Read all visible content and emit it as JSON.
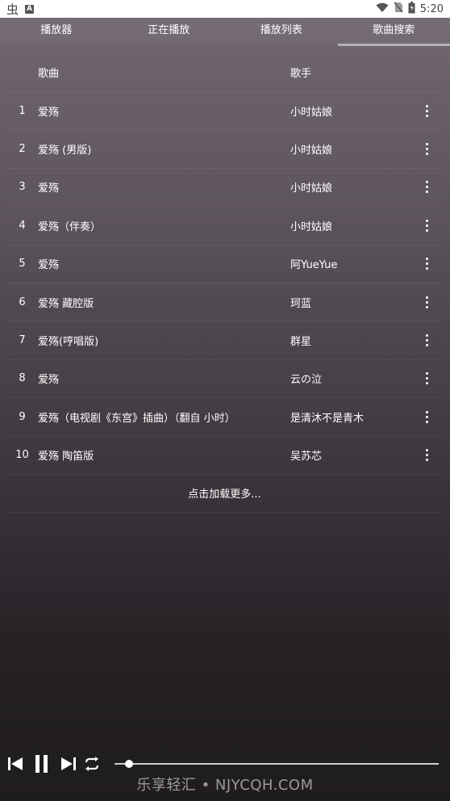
{
  "status_bar": {
    "time": "5:20",
    "notification_glyph": "虫",
    "notification_badge": "A",
    "icons": [
      "wifi-icon",
      "no-sim-icon",
      "battery-icon"
    ]
  },
  "tabs": [
    {
      "label": "播放器",
      "active": false
    },
    {
      "label": "正在播放",
      "active": false
    },
    {
      "label": "播放列表",
      "active": false
    },
    {
      "label": "歌曲搜索",
      "active": true
    }
  ],
  "list": {
    "header_song": "歌曲",
    "header_artist": "歌手",
    "rows": [
      {
        "num": "1",
        "song": "爱殇",
        "artist": "小时姑娘"
      },
      {
        "num": "2",
        "song": "爱殇 (男版)",
        "artist": "小时姑娘"
      },
      {
        "num": "3",
        "song": "爱殇",
        "artist": "小时姑娘"
      },
      {
        "num": "4",
        "song": "爱殇（伴奏）",
        "artist": "小时姑娘"
      },
      {
        "num": "5",
        "song": "爱殇",
        "artist": "阿YueYue"
      },
      {
        "num": "6",
        "song": "爱殇 藏腔版",
        "artist": "珂蓝"
      },
      {
        "num": "7",
        "song": "爱殇(哼唱版)",
        "artist": "群星"
      },
      {
        "num": "8",
        "song": "爱殇",
        "artist": "云の泣"
      },
      {
        "num": "9",
        "song": "爱殇（电视剧《东宫》插曲）（翻自 小时）",
        "artist": "是清沐不是青木"
      },
      {
        "num": "10",
        "song": "爱殇 陶笛版",
        "artist": "吴苏芯"
      }
    ],
    "load_more": "点击加载更多..."
  },
  "player": {
    "progress": 0.045,
    "controls": [
      "skip-previous-icon",
      "pause-icon",
      "skip-next-icon",
      "repeat-icon"
    ]
  },
  "watermark": "乐享轻汇 • NJYCQH.COM"
}
